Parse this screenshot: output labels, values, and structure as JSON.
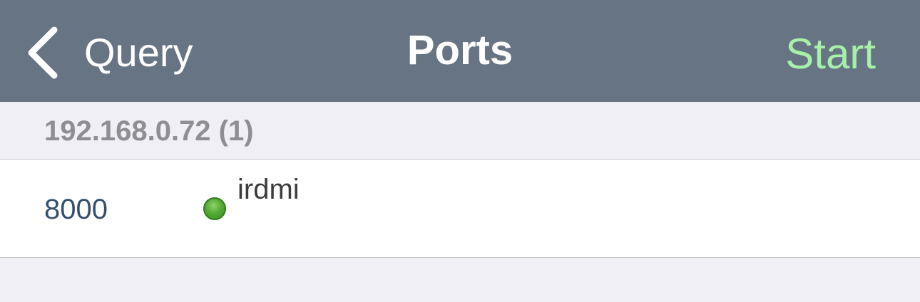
{
  "navbar": {
    "back_label": "Query",
    "title": "Ports",
    "action_label": "Start",
    "action_color": "#a7f0a8"
  },
  "section": {
    "header": "192.168.0.72 (1)"
  },
  "ports": [
    {
      "port": "8000",
      "service": "irdmi",
      "status": "open",
      "status_color": "#54ab35",
      "port_color": "#34506e"
    }
  ],
  "colors": {
    "navbar_bg": "#667484",
    "background": "#f0eff5",
    "section_header_text": "#8e8e93"
  },
  "icons": {
    "back": "chevron-left-icon",
    "status": "green-dot-icon"
  }
}
